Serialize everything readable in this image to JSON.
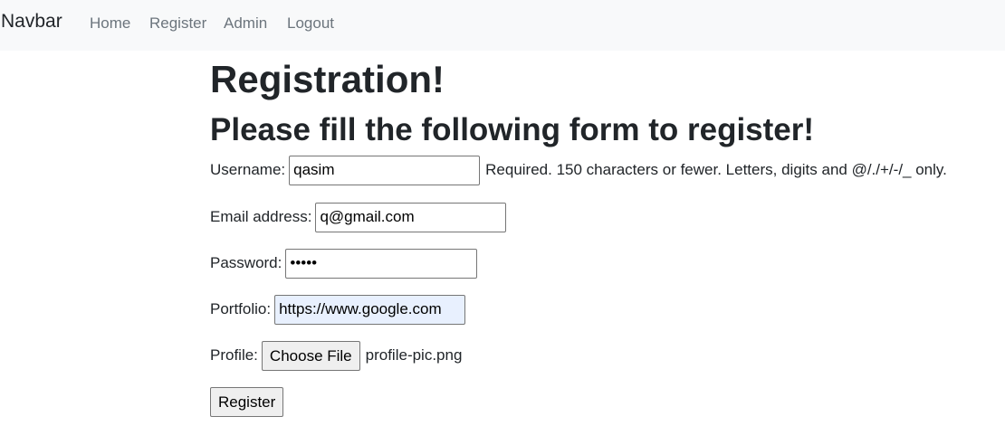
{
  "navbar": {
    "brand": "Navbar",
    "links": [
      "Home",
      "Register",
      "Admin",
      "Logout"
    ]
  },
  "page": {
    "title": "Registration!",
    "subtitle": "Please fill the following form to register!"
  },
  "form": {
    "username": {
      "label": "Username:",
      "value": "qasim",
      "help": "Required. 150 characters or fewer. Letters, digits and @/./+/-/_ only."
    },
    "email": {
      "label": "Email address:",
      "value": "q@gmail.com"
    },
    "password": {
      "label": "Password:",
      "value": "12345"
    },
    "portfolio": {
      "label": "Portfolio:",
      "value": "https://www.google.com"
    },
    "profile": {
      "label": "Profile:",
      "button_label": "Choose File",
      "filename": "profile-pic.png"
    },
    "submit_label": "Register"
  }
}
